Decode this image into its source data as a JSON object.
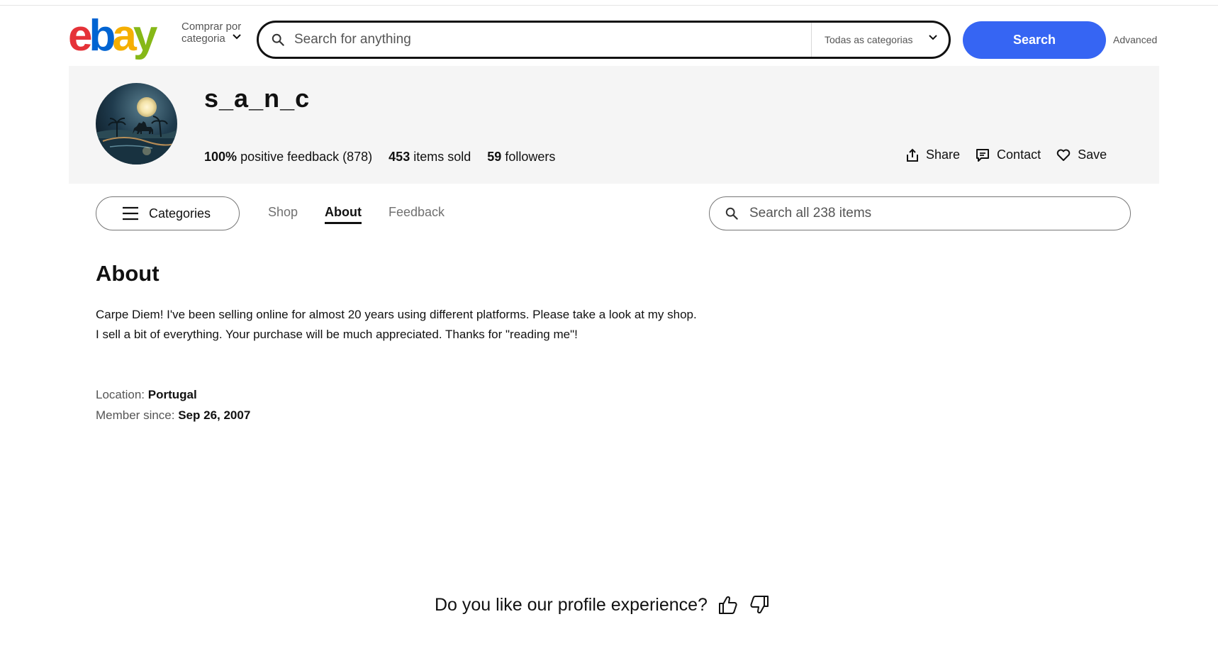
{
  "header": {
    "logo_letters": [
      "e",
      "b",
      "a",
      "y"
    ],
    "logo_colors": [
      "#e53238",
      "#0064d2",
      "#f5af02",
      "#86b817"
    ],
    "shop_by_category": "Comprar por categoria",
    "search_placeholder": "Search for anything",
    "category_select": "Todas as categorias",
    "search_button": "Search",
    "advanced_link": "Advanced",
    "accent_color": "#3665f3"
  },
  "profile": {
    "username": "s_a_n_c",
    "avatar_icon": "moonlit-desert-camel-avatar",
    "feedback_percent": "100%",
    "feedback_text": "positive feedback (878)",
    "items_sold_count": "453",
    "items_sold_text": "items sold",
    "followers_count": "59",
    "followers_text": "followers",
    "actions": {
      "share": "Share",
      "contact": "Contact",
      "save": "Save"
    }
  },
  "nav": {
    "categories_button": "Categories",
    "tabs": [
      {
        "label": "Shop",
        "active": false
      },
      {
        "label": "About",
        "active": true
      },
      {
        "label": "Feedback",
        "active": false
      }
    ],
    "store_search_placeholder": "Search all 238 items"
  },
  "about": {
    "heading": "About",
    "line1": "Carpe Diem! I've been selling online for almost 20 years using different platforms. Please take a look at my shop.",
    "line2": "I sell a bit of everything. Your purchase will be much appreciated. Thanks for \"reading me\"!",
    "location_label": "Location:",
    "location_value": "Portugal",
    "member_since_label": "Member since:",
    "member_since_value": "Sep 26, 2007"
  },
  "survey": {
    "question": "Do you like our profile experience?"
  }
}
